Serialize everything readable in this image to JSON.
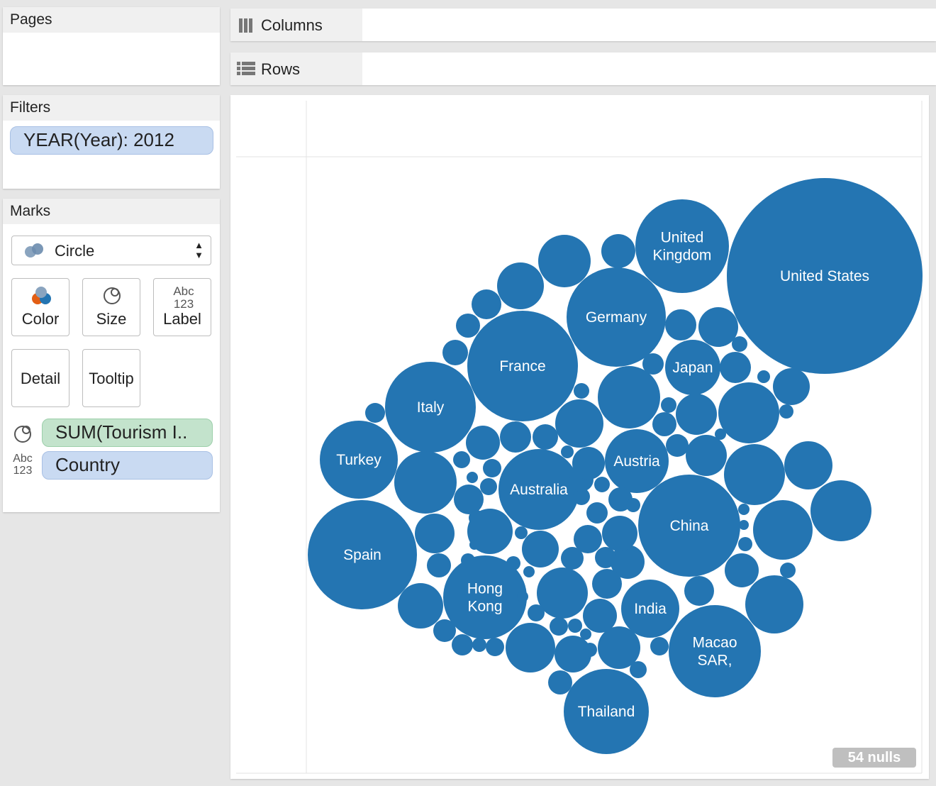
{
  "left_panel": {
    "pages_title": "Pages",
    "filters_title": "Filters",
    "filter_pill": "YEAR(Year): 2012",
    "marks_title": "Marks",
    "mark_type": "Circle",
    "buttons": {
      "color": "Color",
      "size": "Size",
      "label": "Label",
      "detail": "Detail",
      "tooltip": "Tooltip"
    },
    "label_icon_text": "Abc 123",
    "size_pill": "SUM(Tourism I..",
    "label_pill": "Country"
  },
  "shelves": {
    "columns": "Columns",
    "rows": "Rows"
  },
  "nulls_indicator": "54 nulls",
  "colors": {
    "bubble": "#2475b2",
    "filter_pill": "#c9daf2",
    "measure_pill": "#c3e3cc",
    "nulls_badge": "#bfbfbf"
  },
  "chart_data": {
    "type": "packed-bubble",
    "size_measure": "SUM(Tourism I..",
    "label_field": "Country",
    "filter": "YEAR(Year): 2012",
    "labeled_countries": [
      "United States",
      "United Kingdom",
      "Germany",
      "France",
      "Japan",
      "Italy",
      "Turkey",
      "Austria",
      "Australia",
      "China",
      "Spain",
      "Hong Kong",
      "India",
      "Macao SAR,",
      "Thailand"
    ],
    "relative_sizes_estimated": {
      "United States": 1.0,
      "Spain": 0.31,
      "China": 0.26,
      "France": 0.31,
      "Germany": 0.25,
      "United Kingdom": 0.23,
      "Italy": 0.21,
      "Thailand": 0.18,
      "Macao SAR,": 0.22,
      "Hong Kong": 0.18,
      "Turkey": 0.16,
      "Australia": 0.16,
      "Austria": 0.1,
      "India": 0.08,
      "Japan": 0.08
    },
    "nulls": "54 nulls"
  }
}
